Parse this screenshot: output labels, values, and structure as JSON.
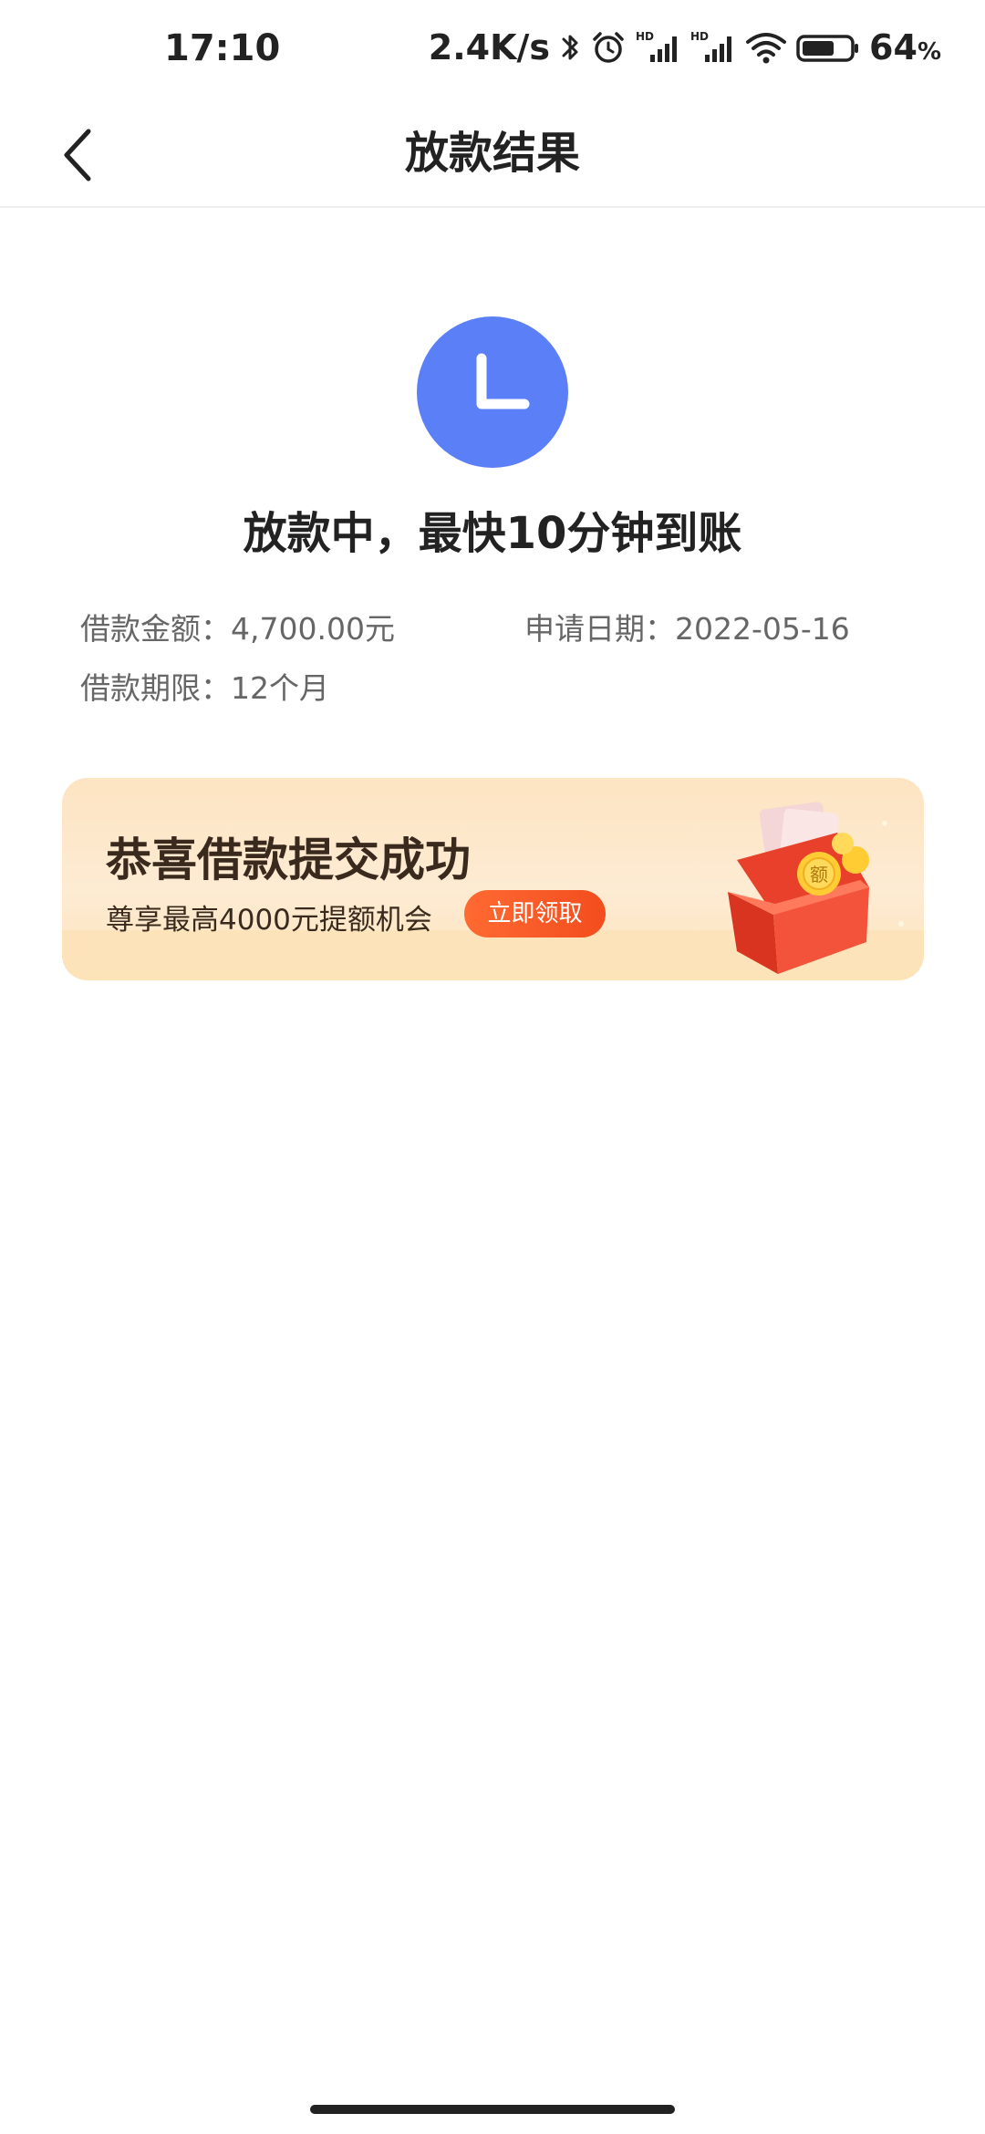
{
  "status_bar": {
    "time": "17:10",
    "net_speed": "2.4K/s",
    "battery_pct": "64",
    "battery_unit": "%",
    "battery_level": 0.64,
    "icons": [
      "bluetooth-icon",
      "alarm-icon",
      "hd-signal-icon",
      "hd-signal-icon",
      "wifi-icon",
      "battery-icon"
    ]
  },
  "nav": {
    "title": "放款结果",
    "back_icon": "chevron-left-icon"
  },
  "result": {
    "status_icon": "clock-icon",
    "status_color": "#5b7ff6",
    "title": "放款中，最快10分钟到账",
    "amount_label": "借款金额：",
    "amount_value": "4,700.00元",
    "date_label": "申请日期：",
    "date_value": "2022-05-16",
    "term_label": "借款期限：",
    "term_value": "12个月"
  },
  "promo": {
    "title": "恭喜借款提交成功",
    "subtitle": "尊享最高4000元提额机会",
    "button_label": "立即领取",
    "art_icon": "red-envelope-gift-icon",
    "art_badge": "额",
    "accent_color": "#f24d1e"
  }
}
